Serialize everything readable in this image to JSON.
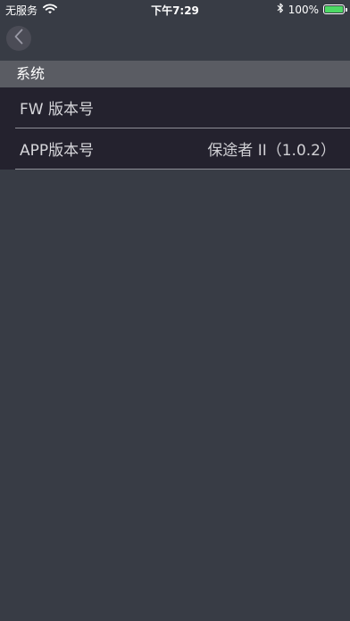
{
  "status_bar": {
    "carrier": "无服务",
    "time": "下午7:29",
    "battery_percent": "100%",
    "battery_level": 1.0
  },
  "nav": {
    "back_icon": "chevron-left-icon"
  },
  "section": {
    "title": "系统"
  },
  "rows": [
    {
      "label": "FW 版本号",
      "value": ""
    },
    {
      "label": "APP版本号",
      "value": "保途者 II（1.0.2）"
    }
  ],
  "colors": {
    "background": "#383c45",
    "section_header": "#5a5c63",
    "list_background": "#24222e",
    "battery": "#4cd964"
  }
}
